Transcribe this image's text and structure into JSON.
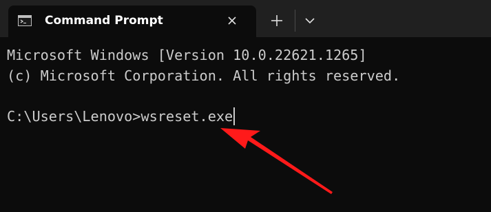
{
  "tab": {
    "title": "Command Prompt",
    "icon": "cmd-icon"
  },
  "toolbar": {
    "new_tab_icon": "plus-icon",
    "dropdown_icon": "chevron-down-icon",
    "close_icon": "close-icon"
  },
  "terminal": {
    "lines": [
      "Microsoft Windows [Version 10.0.22621.1265]",
      "(c) Microsoft Corporation. All rights reserved."
    ],
    "prompt": "C:\\Users\\Lenovo>",
    "command": "wsreset.exe"
  },
  "colors": {
    "background": "#0c0c0c",
    "tab_bar": "#202020",
    "text": "#cccccc",
    "annotation_arrow": "#ff1a1a"
  }
}
